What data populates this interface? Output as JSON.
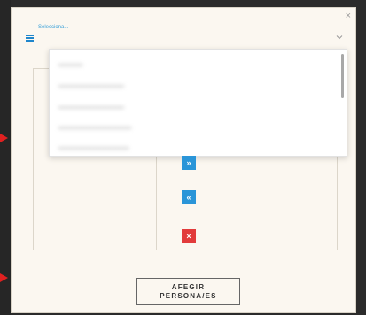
{
  "modal": {
    "close_symbol": "×"
  },
  "selector": {
    "label": "Selecciona...",
    "icon": "hamburger-icon",
    "chevron_icon": "chevron-down-icon",
    "accent_color": "#1f86cc"
  },
  "dropdown": {
    "options": [
      "••••••••••",
      "•••••••••••••••••••••••••••",
      "•••••••••••••••••••••••••••",
      "••••••••••••••••••••••••••••••",
      "•••••••••••••••••••••••••••••"
    ]
  },
  "transfer": {
    "move_right_symbol": "»",
    "move_left_symbol": "«",
    "clear_symbol": "×",
    "move_color": "#2a95d8",
    "clear_color": "#e23b3b"
  },
  "actions": {
    "add_line1": "AFEGIR",
    "add_line2": "PERSONA/ES"
  },
  "annotations": {
    "arrow_color": "#e02020"
  }
}
